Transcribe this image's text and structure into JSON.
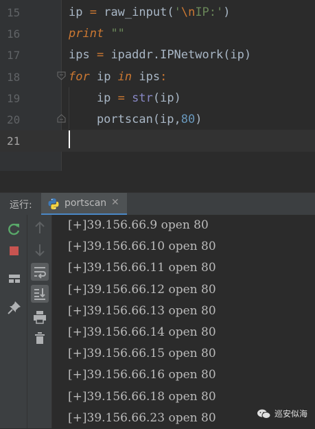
{
  "editor": {
    "lines": [
      {
        "number": "15",
        "parts": [
          [
            "ip",
            ""
          ],
          [
            " = ",
            "kw"
          ],
          [
            "raw_input",
            ""
          ],
          [
            "(",
            ""
          ],
          [
            "'",
            "str"
          ],
          [
            "\\n",
            "esc"
          ],
          [
            "IP:'",
            "str"
          ],
          [
            ")",
            ""
          ]
        ]
      },
      {
        "number": "16",
        "parts": [
          [
            "print",
            "kw it"
          ],
          [
            " ",
            ""
          ],
          [
            "\"\"",
            "str it"
          ]
        ]
      },
      {
        "number": "17",
        "parts": [
          [
            "ips ",
            ""
          ],
          [
            "=",
            "kw"
          ],
          [
            " ipaddr.IPNetwork(ip)",
            ""
          ]
        ]
      },
      {
        "number": "18",
        "parts": [
          [
            "for",
            "kw it"
          ],
          [
            " ip ",
            ""
          ],
          [
            "in",
            "kw it"
          ],
          [
            " ips",
            ""
          ],
          [
            ":",
            "kw"
          ]
        ]
      },
      {
        "number": "19",
        "parts": [
          [
            "    ip ",
            ""
          ],
          [
            "=",
            "kw"
          ],
          [
            " ",
            ""
          ],
          [
            "str",
            "builtin"
          ],
          [
            "(ip)",
            ""
          ]
        ]
      },
      {
        "number": "20",
        "parts": [
          [
            "    portscan(ip,",
            ""
          ],
          [
            "80",
            "num"
          ],
          [
            ")",
            ""
          ]
        ]
      },
      {
        "number": "21",
        "parts": []
      }
    ]
  },
  "run_panel": {
    "label": "运行:",
    "tab_label": "portscan",
    "tab_close": "✕"
  },
  "console": {
    "lines": [
      "[+]39.156.66.9 open 80",
      "[+]39.156.66.10 open 80",
      "[+]39.156.66.11 open 80",
      "[+]39.156.66.12 open 80",
      "[+]39.156.66.13 open 80",
      "[+]39.156.66.14 open 80",
      "[+]39.156.66.15 open 80",
      "[+]39.156.66.16 open 80",
      "[+]39.156.66.18 open 80",
      "[+]39.156.66.23 open 80"
    ]
  },
  "watermark": {
    "text": "巡安似海"
  },
  "icons": {
    "rerun": "rerun-icon",
    "stop": "stop-icon",
    "layout": "layout-icon",
    "pin": "pin-icon",
    "up": "arrow-up-icon",
    "down": "arrow-down-icon",
    "softwrap": "soft-wrap-icon",
    "scroll_end": "scroll-to-end-icon",
    "print": "print-icon",
    "trash": "trash-icon"
  }
}
